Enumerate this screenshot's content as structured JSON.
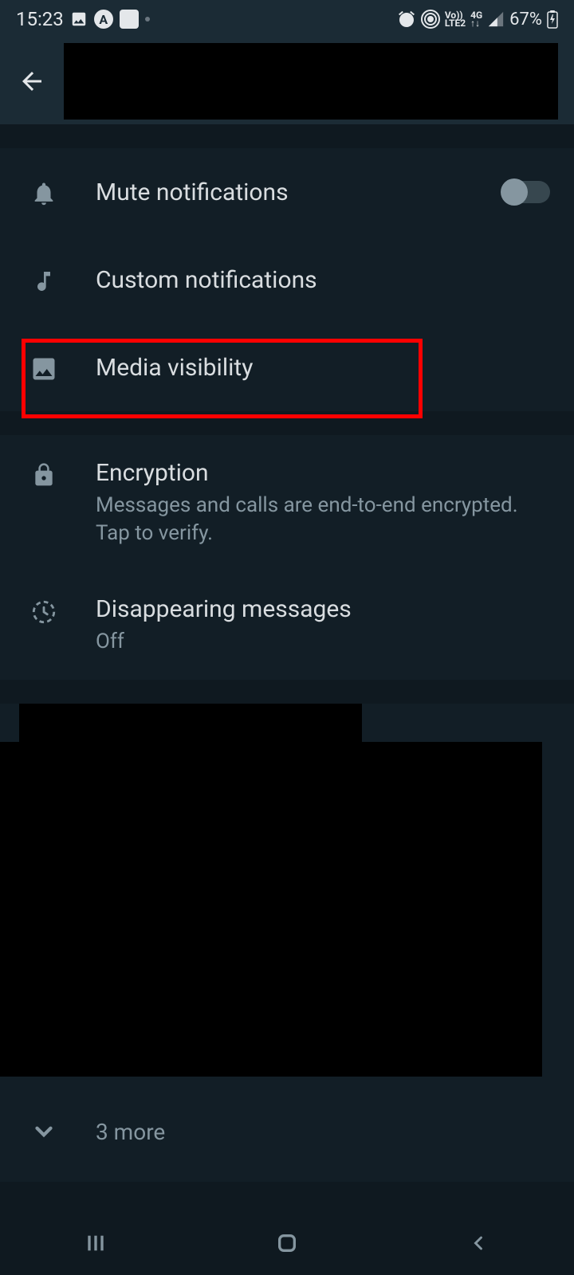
{
  "status_bar": {
    "time": "15:23",
    "network_label_1": "Vo))",
    "network_label_2": "LTE2",
    "network_label_3": "4G",
    "battery_percent": "67%"
  },
  "settings": {
    "mute_notifications": {
      "label": "Mute notifications",
      "toggle_on": false
    },
    "custom_notifications": {
      "label": "Custom notifications"
    },
    "media_visibility": {
      "label": "Media visibility"
    },
    "encryption": {
      "label": "Encryption",
      "subtitle": "Messages and calls are end-to-end encrypted. Tap to verify."
    },
    "disappearing_messages": {
      "label": "Disappearing messages",
      "value": "Off"
    }
  },
  "groups": {
    "more_label": "3 more"
  }
}
